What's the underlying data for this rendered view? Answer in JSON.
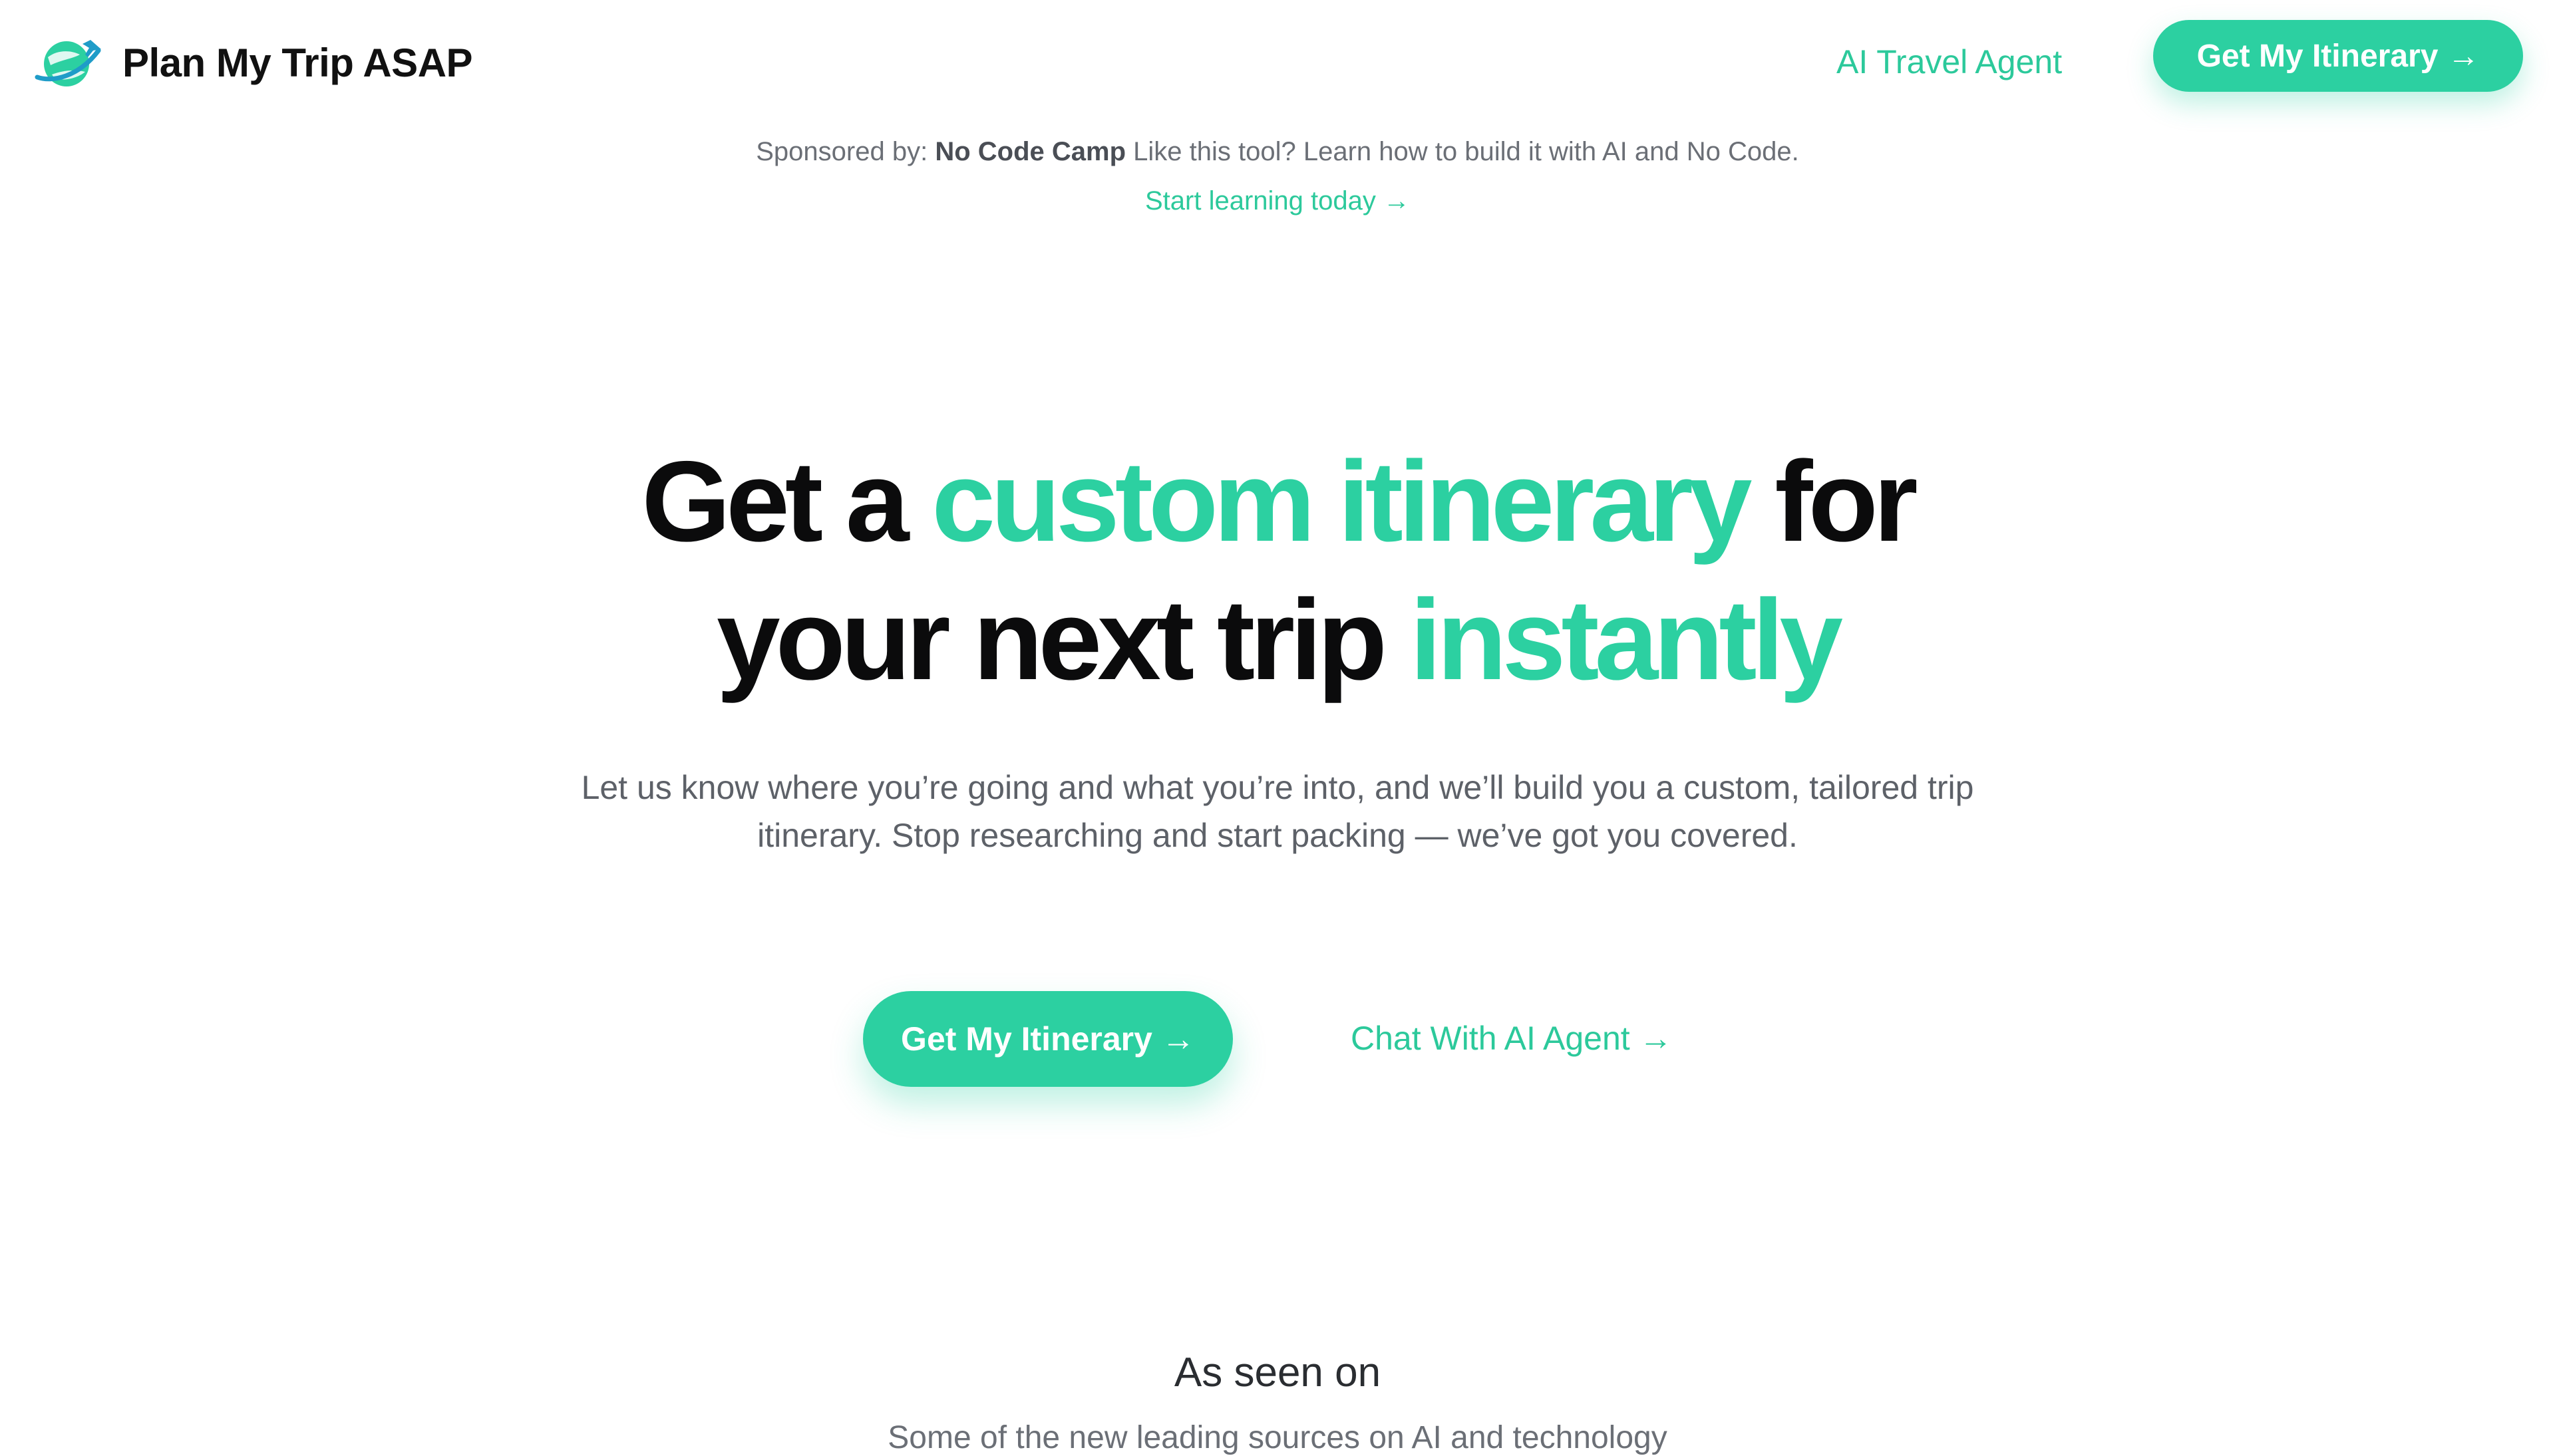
{
  "header": {
    "brand_name": "Plan My Trip ASAP",
    "nav_link": "AI Travel Agent",
    "cta_label": "Get My Itinerary",
    "cta_arrow": "→"
  },
  "sponsor": {
    "prefix": "Sponsored by:",
    "name": "No Code Camp",
    "text": "Like this tool? Learn how to build it with AI and No Code.",
    "link_label": "Start learning today →"
  },
  "hero": {
    "title_line1_a": "Get a",
    "title_line1_accent": "custom itinerary",
    "title_line1_b": "for",
    "title_line2_a": "your next trip",
    "title_line2_accent": "instantly",
    "subtitle": "Let us know where you’re going and what you’re into, and we’ll build you a custom, tailored trip itinerary. Stop researching and start packing — we’ve got you covered.",
    "primary_cta": "Get My Itinerary",
    "primary_arrow": "→",
    "secondary_cta": "Chat With AI Agent →"
  },
  "as_seen_on": {
    "title": "As seen on",
    "subtitle": "Some of the new leading sources on AI and technology"
  },
  "colors": {
    "accent": "#2cd0a1",
    "text": "#0b0b0c",
    "muted": "#5d6168"
  },
  "icons": {
    "logo": "globe-plane-icon"
  }
}
